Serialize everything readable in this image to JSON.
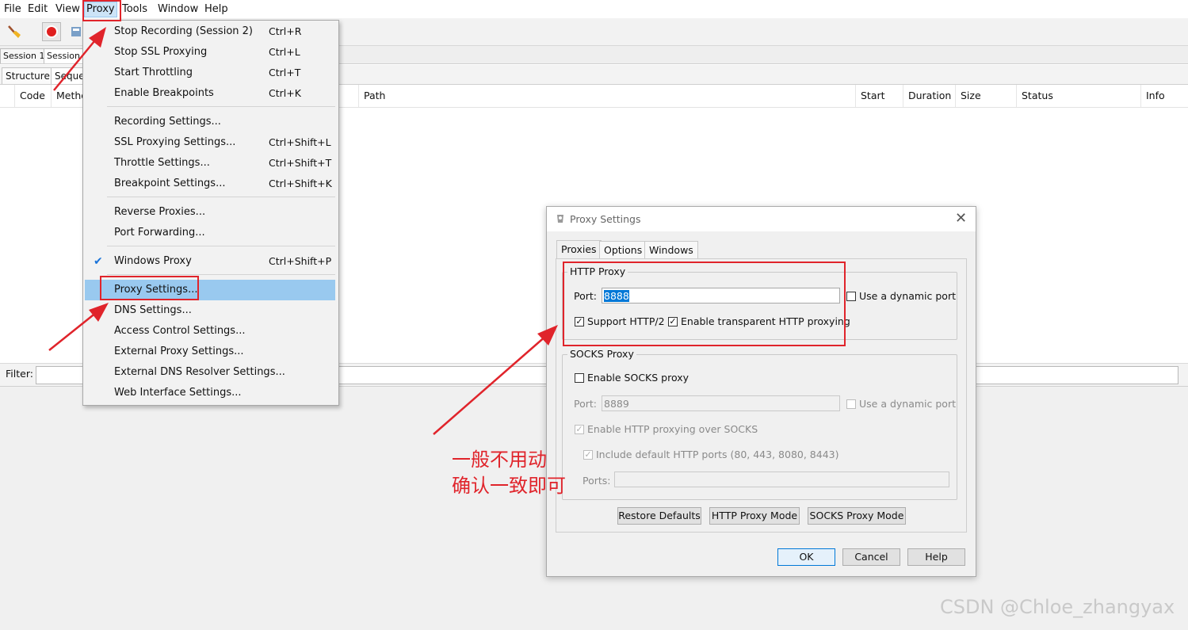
{
  "menubar": [
    "File",
    "Edit",
    "View",
    "Proxy",
    "Tools",
    "Window",
    "Help"
  ],
  "session_tabs": [
    "Session 1",
    "Session"
  ],
  "view_tabs": [
    "Structure",
    "Seque"
  ],
  "table_headers": {
    "code": "Code",
    "method": "Metho",
    "path": "Path",
    "start": "Start",
    "duration": "Duration",
    "size": "Size",
    "status": "Status",
    "info": "Info"
  },
  "filter": {
    "label": "Filter:",
    "value": ""
  },
  "proxy_menu": {
    "items": [
      {
        "label": "Stop Recording (Session 2)",
        "shortcut": "Ctrl+R"
      },
      {
        "label": "Stop SSL Proxying",
        "shortcut": "Ctrl+L"
      },
      {
        "label": "Start Throttling",
        "shortcut": "Ctrl+T"
      },
      {
        "label": "Enable Breakpoints",
        "shortcut": "Ctrl+K"
      },
      {
        "label": "Recording Settings...",
        "shortcut": ""
      },
      {
        "label": "SSL Proxying Settings...",
        "shortcut": "Ctrl+Shift+L"
      },
      {
        "label": "Throttle Settings...",
        "shortcut": "Ctrl+Shift+T"
      },
      {
        "label": "Breakpoint Settings...",
        "shortcut": "Ctrl+Shift+K"
      },
      {
        "label": "Reverse Proxies...",
        "shortcut": ""
      },
      {
        "label": "Port Forwarding...",
        "shortcut": ""
      },
      {
        "label": "Windows Proxy",
        "shortcut": "Ctrl+Shift+P",
        "checked": true
      },
      {
        "label": "Proxy Settings...",
        "shortcut": "",
        "highlighted": true
      },
      {
        "label": "DNS Settings...",
        "shortcut": ""
      },
      {
        "label": "Access Control Settings...",
        "shortcut": ""
      },
      {
        "label": "External Proxy Settings...",
        "shortcut": ""
      },
      {
        "label": "External DNS Resolver Settings...",
        "shortcut": ""
      },
      {
        "label": "Web Interface Settings...",
        "shortcut": ""
      }
    ]
  },
  "dialog": {
    "title": "Proxy Settings",
    "tabs": [
      "Proxies",
      "Options",
      "Windows"
    ],
    "http_proxy": {
      "group_label": "HTTP Proxy",
      "port_label": "Port:",
      "port_value": "8888",
      "dynamic_port_label": "Use a dynamic port",
      "dynamic_port_checked": false,
      "http2_label": "Support HTTP/2",
      "http2_checked": true,
      "transparent_label": "Enable transparent HTTP proxying",
      "transparent_checked": true
    },
    "socks_proxy": {
      "group_label": "SOCKS Proxy",
      "enable_label": "Enable SOCKS proxy",
      "enable_checked": false,
      "port_label": "Port:",
      "port_value": "8889",
      "dynamic_port_label": "Use a dynamic port",
      "http_over_socks_label": "Enable HTTP proxying over SOCKS",
      "include_default_label": "Include default HTTP ports (80, 443, 8080, 8443)",
      "ports_label": "Ports:",
      "ports_value": ""
    },
    "buttons": {
      "restore": "Restore Defaults",
      "http_mode": "HTTP Proxy Mode",
      "socks_mode": "SOCKS Proxy Mode",
      "ok": "OK",
      "cancel": "Cancel",
      "help": "Help"
    }
  },
  "annotation": {
    "line1": "一般不用动",
    "line2": "确认一致即可",
    "color": "#e0242b"
  },
  "watermark": "CSDN @Chloe_zhangyax",
  "colors": {
    "menu_highlight": "#99c9ef",
    "accent_blue": "#0078d7",
    "annotation_red": "#e0242b"
  }
}
